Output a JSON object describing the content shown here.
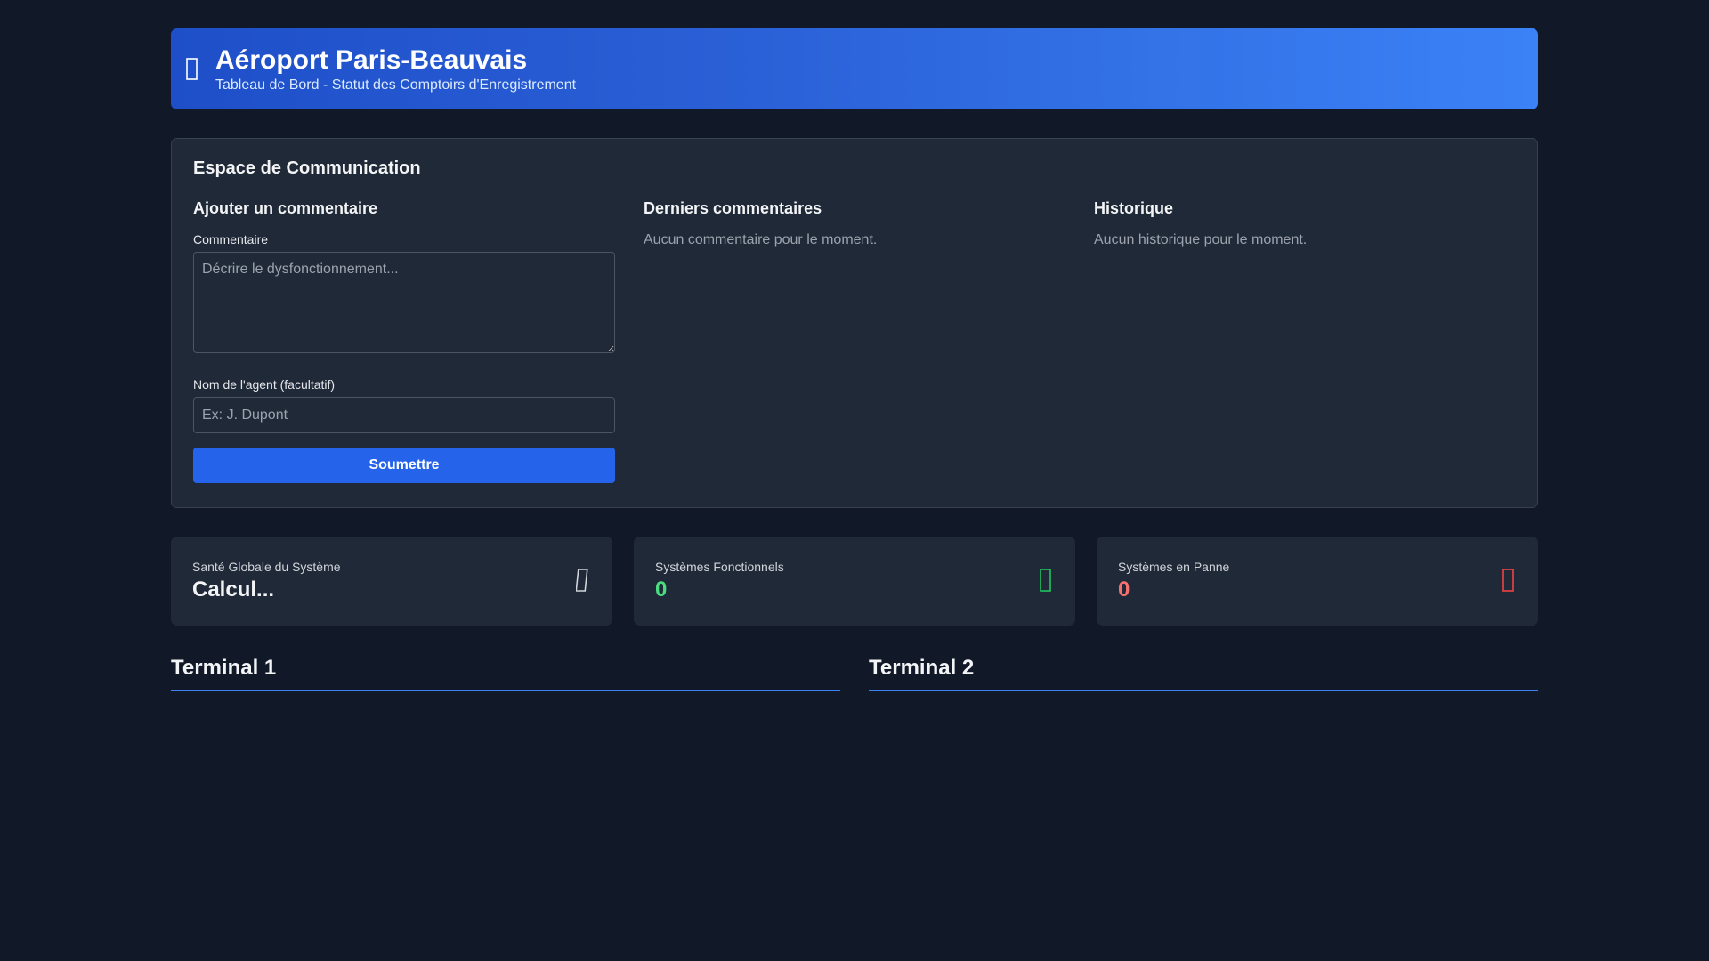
{
  "header": {
    "title": "Aéroport Paris-Beauvais",
    "subtitle": "Tableau de Bord - Statut des Comptoirs d'Enregistrement",
    "icon": "plane-icon"
  },
  "communication": {
    "title": "Espace de Communication",
    "add_comment": {
      "heading": "Ajouter un commentaire",
      "comment_label": "Commentaire",
      "comment_value": "",
      "comment_placeholder": "Décrire le dysfonctionnement...",
      "agent_label": "Nom de l'agent (facultatif)",
      "agent_value": "",
      "agent_placeholder": "Ex: J. Dupont",
      "submit_label": "Soumettre"
    },
    "recent": {
      "heading": "Derniers commentaires",
      "empty": "Aucun commentaire pour le moment."
    },
    "history": {
      "heading": "Historique",
      "empty": "Aucun historique pour le moment."
    }
  },
  "stats": [
    {
      "label": "Santé Globale du Système",
      "value": "Calcul...",
      "icon": "heartbeat-icon",
      "color": "#f3f4f6"
    },
    {
      "label": "Systèmes Fonctionnels",
      "value": "0",
      "icon": "check-circle-icon",
      "color": "#4ade80"
    },
    {
      "label": "Systèmes en Panne",
      "value": "0",
      "icon": "warning-icon",
      "color": "#f87171"
    }
  ],
  "terminals": [
    {
      "name": "Terminal 1"
    },
    {
      "name": "Terminal 2"
    }
  ],
  "colors": {
    "background": "#111827",
    "panel": "#1f2937",
    "accent": "#2563eb",
    "success": "#4ade80",
    "danger": "#f87171"
  }
}
